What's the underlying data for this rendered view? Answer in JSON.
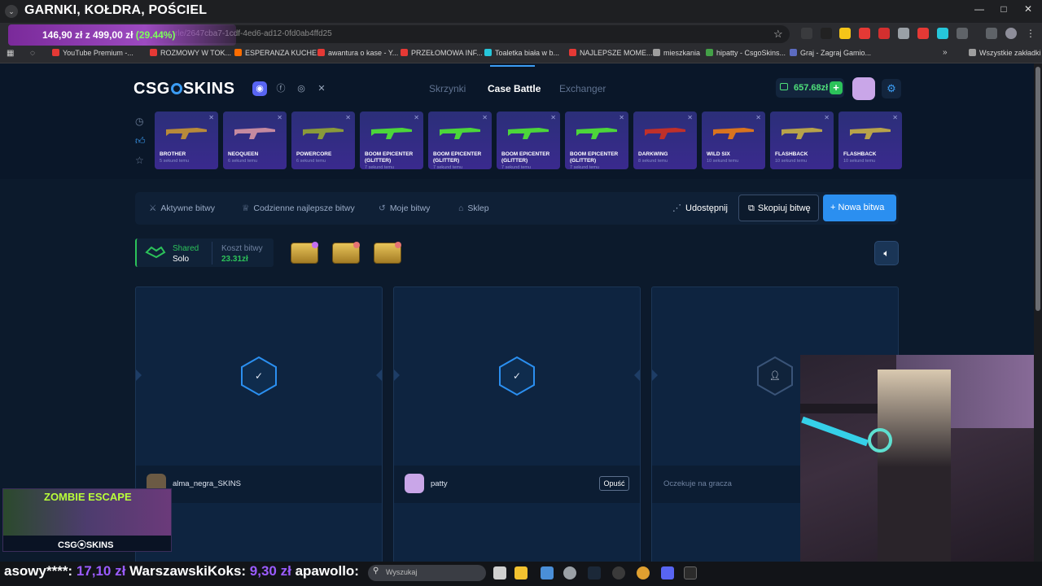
{
  "browser": {
    "window_title": "GARNKI, KOŁDRA, POŚCIEL",
    "url_fragment": "rle/2647cba7-1cdf-4ed6-ad12-0fd0ab4ffd25",
    "promo": {
      "price_now": "146,90 zł",
      "price_was": "z 499,00 zł",
      "discount": "(29.44%)"
    },
    "bookmarks": [
      {
        "label": "YouTube Premium -...",
        "color": "#e53935"
      },
      {
        "label": "ROZMOWY W TOK...",
        "color": "#e53935"
      },
      {
        "label": "ESPERANZA KUCHE...",
        "color": "#ff6d00"
      },
      {
        "label": "awantura o kase - Y...",
        "color": "#e53935"
      },
      {
        "label": "PRZEŁOMOWA INF...",
        "color": "#e53935"
      },
      {
        "label": "Toaletka biała w b...",
        "color": "#26c6da"
      },
      {
        "label": "NAJLEPSZE MOME...",
        "color": "#e53935"
      },
      {
        "label": "mieszkania",
        "color": "#9e9e9e"
      },
      {
        "label": "hipatty - CsgoSkins...",
        "color": "#43a047"
      },
      {
        "label": "Graj - Zagraj Gamio...",
        "color": "#5c6bc0"
      }
    ],
    "bookmarks_all": "Wszystkie zakładki"
  },
  "site": {
    "logo_left": "CSG",
    "logo_right": "SKINS",
    "nav": {
      "skrzynki": "Skrzynki",
      "case_battle": "Case Battle",
      "exchanger": "Exchanger"
    },
    "balance": "657.68zł",
    "balance_plus": "+",
    "drops": [
      {
        "name": "BROTHER",
        "time": "5 sekund temu",
        "color": "#b88a3a"
      },
      {
        "name": "NEOQUEEN",
        "time": "6 sekund temu",
        "color": "#c58aa0"
      },
      {
        "name": "POWERCORE",
        "time": "6 sekund temu",
        "color": "#8a9a3a"
      },
      {
        "name": "BOOM EPICENTER (GLITTER)",
        "time": "7 sekund temu",
        "color": "#4cd63a"
      },
      {
        "name": "BOOM EPICENTER (GLITTER)",
        "time": "7 sekund temu",
        "color": "#4cd63a"
      },
      {
        "name": "BOOM EPICENTER (GLITTER)",
        "time": "7 sekund temu",
        "color": "#4cd63a"
      },
      {
        "name": "BOOM EPICENTER (GLITTER)",
        "time": "7 sekund temu",
        "color": "#4cd63a"
      },
      {
        "name": "DARKWING",
        "time": "8 sekund temu",
        "color": "#c0302a"
      },
      {
        "name": "WILD SIX",
        "time": "10 sekund temu",
        "color": "#d8741f"
      },
      {
        "name": "FLASHBACK",
        "time": "10 sekund temu",
        "color": "#b8a34a"
      },
      {
        "name": "FLASHBACK",
        "time": "10 sekund temu",
        "color": "#b8a34a"
      }
    ],
    "battle_bar": {
      "active": "Aktywne bitwy",
      "daily": "Codzienne najlepsze bitwy",
      "mine": "Moje bitwy",
      "shop": "Sklep",
      "share": "Udostępnij",
      "copy": "Skopiuj bitwę",
      "new": "+ Nowa bitwa"
    },
    "battle_info": {
      "mode_type": "Shared",
      "mode": "Solo",
      "cost_label": "Koszt bitwy",
      "cost": "23.31zł"
    },
    "slots": [
      {
        "player": "alma_negra_SKINS",
        "status": "✓"
      },
      {
        "player": "patty",
        "status": "✓",
        "leave": "Opuść"
      },
      {
        "player": "Oczekuje na gracza",
        "status": "person-icon"
      }
    ]
  },
  "overlays": {
    "promo_title": "ZOMBIE ESCAPE",
    "promo_logo": "CSG⦿SKINS",
    "ticker": [
      {
        "user": "asowy****:",
        "amount": "17,10 zł"
      },
      {
        "user": "WarszawskiKoks:",
        "amount": "9,30 zł"
      },
      {
        "user": "apawollo:",
        "amount": ""
      }
    ],
    "taskbar_search": "Wyszukaj"
  },
  "colors": {
    "accent": "#2b8ff0",
    "success": "#2cc25a",
    "bg": "#0c1a2c"
  }
}
